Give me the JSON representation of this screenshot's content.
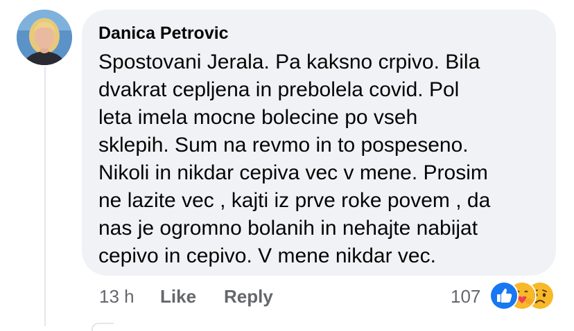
{
  "comment": {
    "author": "Danica Petrovic",
    "lines": [
      "Spostovani Jerala. Pa kaksno crpivo. Bila",
      "dvakrat cepljena in prebolela covid. Pol",
      "leta imela mocne bolecine po vseh",
      "sklepih. Sum na revmo in to pospeseno.",
      "Nikoli in nikdar cepiva vec v mene. Prosim",
      "ne lazite vec , kajti iz prve roke povem , da",
      "nas je ogromno bolanih in nehajte nabijat",
      "cepivo in cepivo. V mene nikdar vec."
    ]
  },
  "actions": {
    "timestamp": "13 h",
    "like_label": "Like",
    "reply_label": "Reply"
  },
  "reactions": {
    "count": "107",
    "icons": [
      "like-icon",
      "care-icon",
      "sad-icon"
    ]
  },
  "colors": {
    "bubble": "#f0f2f5",
    "text": "#050505",
    "meta": "#65676b",
    "like_blue": "#1877f2",
    "emoji_yellow": "#f7b928"
  }
}
